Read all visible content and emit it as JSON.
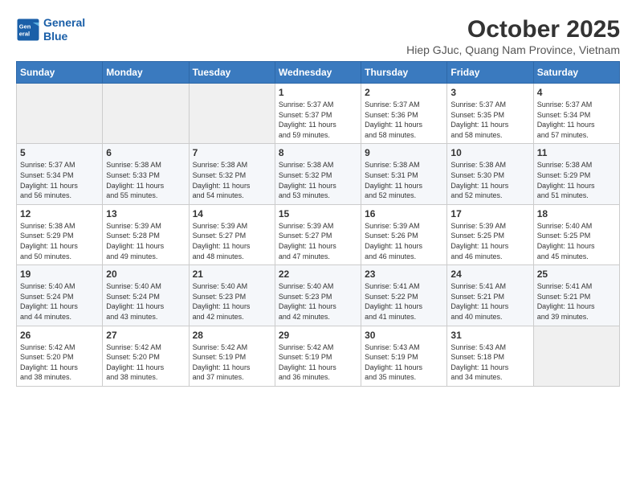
{
  "header": {
    "logo_line1": "General",
    "logo_line2": "Blue",
    "title": "October 2025",
    "subtitle": "Hiep GJuc, Quang Nam Province, Vietnam"
  },
  "days_of_week": [
    "Sunday",
    "Monday",
    "Tuesday",
    "Wednesday",
    "Thursday",
    "Friday",
    "Saturday"
  ],
  "weeks": [
    [
      {
        "day": "",
        "info": ""
      },
      {
        "day": "",
        "info": ""
      },
      {
        "day": "",
        "info": ""
      },
      {
        "day": "1",
        "info": "Sunrise: 5:37 AM\nSunset: 5:37 PM\nDaylight: 11 hours\nand 59 minutes."
      },
      {
        "day": "2",
        "info": "Sunrise: 5:37 AM\nSunset: 5:36 PM\nDaylight: 11 hours\nand 58 minutes."
      },
      {
        "day": "3",
        "info": "Sunrise: 5:37 AM\nSunset: 5:35 PM\nDaylight: 11 hours\nand 58 minutes."
      },
      {
        "day": "4",
        "info": "Sunrise: 5:37 AM\nSunset: 5:34 PM\nDaylight: 11 hours\nand 57 minutes."
      }
    ],
    [
      {
        "day": "5",
        "info": "Sunrise: 5:37 AM\nSunset: 5:34 PM\nDaylight: 11 hours\nand 56 minutes."
      },
      {
        "day": "6",
        "info": "Sunrise: 5:38 AM\nSunset: 5:33 PM\nDaylight: 11 hours\nand 55 minutes."
      },
      {
        "day": "7",
        "info": "Sunrise: 5:38 AM\nSunset: 5:32 PM\nDaylight: 11 hours\nand 54 minutes."
      },
      {
        "day": "8",
        "info": "Sunrise: 5:38 AM\nSunset: 5:32 PM\nDaylight: 11 hours\nand 53 minutes."
      },
      {
        "day": "9",
        "info": "Sunrise: 5:38 AM\nSunset: 5:31 PM\nDaylight: 11 hours\nand 52 minutes."
      },
      {
        "day": "10",
        "info": "Sunrise: 5:38 AM\nSunset: 5:30 PM\nDaylight: 11 hours\nand 52 minutes."
      },
      {
        "day": "11",
        "info": "Sunrise: 5:38 AM\nSunset: 5:29 PM\nDaylight: 11 hours\nand 51 minutes."
      }
    ],
    [
      {
        "day": "12",
        "info": "Sunrise: 5:38 AM\nSunset: 5:29 PM\nDaylight: 11 hours\nand 50 minutes."
      },
      {
        "day": "13",
        "info": "Sunrise: 5:39 AM\nSunset: 5:28 PM\nDaylight: 11 hours\nand 49 minutes."
      },
      {
        "day": "14",
        "info": "Sunrise: 5:39 AM\nSunset: 5:27 PM\nDaylight: 11 hours\nand 48 minutes."
      },
      {
        "day": "15",
        "info": "Sunrise: 5:39 AM\nSunset: 5:27 PM\nDaylight: 11 hours\nand 47 minutes."
      },
      {
        "day": "16",
        "info": "Sunrise: 5:39 AM\nSunset: 5:26 PM\nDaylight: 11 hours\nand 46 minutes."
      },
      {
        "day": "17",
        "info": "Sunrise: 5:39 AM\nSunset: 5:25 PM\nDaylight: 11 hours\nand 46 minutes."
      },
      {
        "day": "18",
        "info": "Sunrise: 5:40 AM\nSunset: 5:25 PM\nDaylight: 11 hours\nand 45 minutes."
      }
    ],
    [
      {
        "day": "19",
        "info": "Sunrise: 5:40 AM\nSunset: 5:24 PM\nDaylight: 11 hours\nand 44 minutes."
      },
      {
        "day": "20",
        "info": "Sunrise: 5:40 AM\nSunset: 5:24 PM\nDaylight: 11 hours\nand 43 minutes."
      },
      {
        "day": "21",
        "info": "Sunrise: 5:40 AM\nSunset: 5:23 PM\nDaylight: 11 hours\nand 42 minutes."
      },
      {
        "day": "22",
        "info": "Sunrise: 5:40 AM\nSunset: 5:23 PM\nDaylight: 11 hours\nand 42 minutes."
      },
      {
        "day": "23",
        "info": "Sunrise: 5:41 AM\nSunset: 5:22 PM\nDaylight: 11 hours\nand 41 minutes."
      },
      {
        "day": "24",
        "info": "Sunrise: 5:41 AM\nSunset: 5:21 PM\nDaylight: 11 hours\nand 40 minutes."
      },
      {
        "day": "25",
        "info": "Sunrise: 5:41 AM\nSunset: 5:21 PM\nDaylight: 11 hours\nand 39 minutes."
      }
    ],
    [
      {
        "day": "26",
        "info": "Sunrise: 5:42 AM\nSunset: 5:20 PM\nDaylight: 11 hours\nand 38 minutes."
      },
      {
        "day": "27",
        "info": "Sunrise: 5:42 AM\nSunset: 5:20 PM\nDaylight: 11 hours\nand 38 minutes."
      },
      {
        "day": "28",
        "info": "Sunrise: 5:42 AM\nSunset: 5:19 PM\nDaylight: 11 hours\nand 37 minutes."
      },
      {
        "day": "29",
        "info": "Sunrise: 5:42 AM\nSunset: 5:19 PM\nDaylight: 11 hours\nand 36 minutes."
      },
      {
        "day": "30",
        "info": "Sunrise: 5:43 AM\nSunset: 5:19 PM\nDaylight: 11 hours\nand 35 minutes."
      },
      {
        "day": "31",
        "info": "Sunrise: 5:43 AM\nSunset: 5:18 PM\nDaylight: 11 hours\nand 34 minutes."
      },
      {
        "day": "",
        "info": ""
      }
    ]
  ]
}
